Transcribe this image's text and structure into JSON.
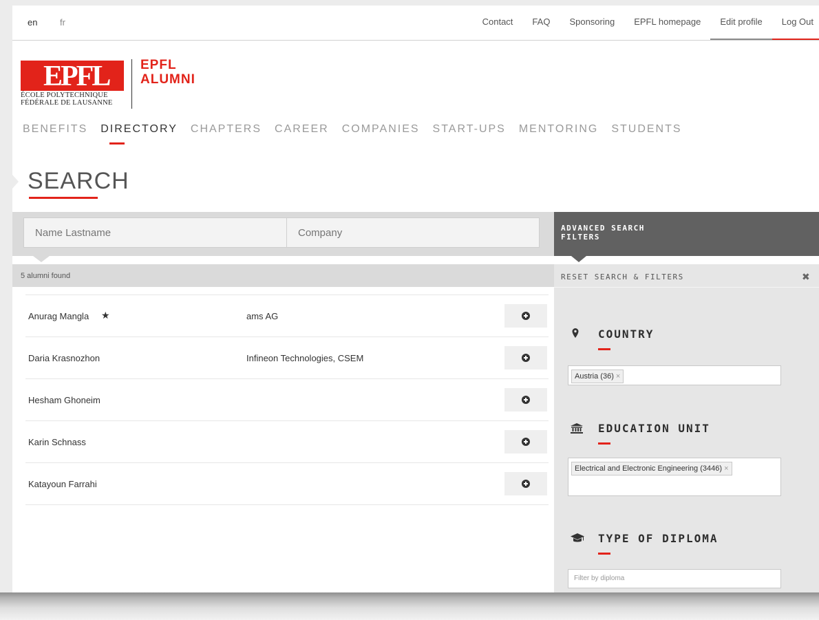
{
  "languages": [
    "en",
    "fr"
  ],
  "top_links": [
    "Contact",
    "FAQ",
    "Sponsoring",
    "EPFL homepage",
    "Edit profile",
    "Log Out"
  ],
  "logo": {
    "mark": "EPFL",
    "school_line1": "ÉCOLE POLYTECHNIQUE",
    "school_line2": "FÉDÉRALE DE LAUSANNE",
    "brand_line1": "EPFL",
    "brand_line2": "ALUMNI"
  },
  "nav": [
    "BENEFITS",
    "DIRECTORY",
    "CHAPTERS",
    "CAREER",
    "COMPANIES",
    "START-UPS",
    "MENTORING",
    "STUDENTS"
  ],
  "nav_active": "DIRECTORY",
  "page_title": "SEARCH",
  "search": {
    "name_placeholder": "Name Lastname",
    "company_placeholder": "Company"
  },
  "results_count": "5 alumni found",
  "results": [
    {
      "name": "Anurag Mangla",
      "starred": true,
      "company": "ams AG"
    },
    {
      "name": "Daria Krasnozhon",
      "starred": false,
      "company": "Infineon Technologies, CSEM"
    },
    {
      "name": "Hesham Ghoneim",
      "starred": false,
      "company": ""
    },
    {
      "name": "Karin Schnass",
      "starred": false,
      "company": ""
    },
    {
      "name": "Katayoun Farrahi",
      "starred": false,
      "company": ""
    }
  ],
  "advanced": {
    "title_line1": "ADVANCED SEARCH",
    "title_line2": "FILTERS",
    "reset_label": "RESET SEARCH & FILTERS"
  },
  "filters": {
    "country": {
      "title": "COUNTRY",
      "icon": "map-pin-icon",
      "selected": "Austria (36)"
    },
    "education_unit": {
      "title": "EDUCATION UNIT",
      "icon": "institution-icon",
      "selected": "Electrical and Electronic Engineering (3446)"
    },
    "diploma": {
      "title": "TYPE OF DIPLOMA",
      "icon": "graduation-cap-icon",
      "placeholder": "Filter by diploma"
    }
  },
  "colors": {
    "accent": "#e2231a",
    "panel_dark": "#616161",
    "panel_light": "#e6e6e6"
  }
}
